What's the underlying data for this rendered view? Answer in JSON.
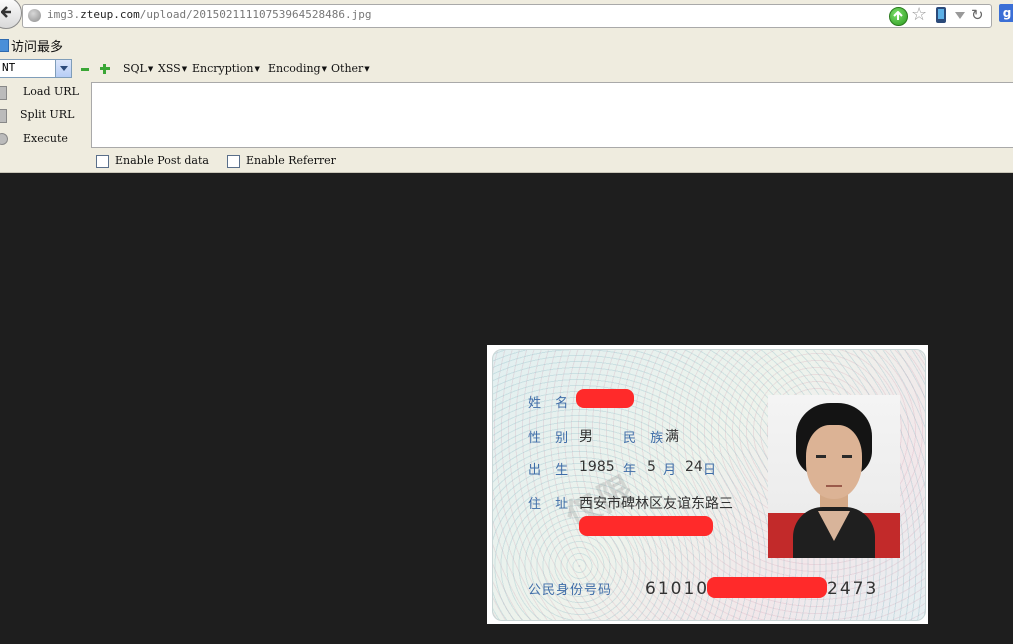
{
  "browser": {
    "url_prefix": "img3.",
    "url_domain": "zteup.com",
    "url_path": "/upload/20150211110753964528486.jpg"
  },
  "bookmarks": {
    "items": [
      {
        "label": "访问最多",
        "icon": "bookmark-folder-icon"
      }
    ]
  },
  "hackbar": {
    "select_value": "NT",
    "menus": [
      {
        "label": "SQL"
      },
      {
        "label": "XSS"
      },
      {
        "label": "Encryption"
      },
      {
        "label": "Encoding"
      },
      {
        "label": "Other"
      }
    ],
    "buttons": {
      "load_url": "Load URL",
      "split_url": "Split URL",
      "execute": "Execute"
    },
    "textarea_value": "",
    "checkboxes": {
      "post_data": "Enable Post data",
      "referrer": "Enable Referrer"
    }
  },
  "id_card": {
    "name_label": "姓 名",
    "gender_label": "性 别",
    "gender_value": "男",
    "ethnicity_label": "民 族",
    "ethnicity_value": "满",
    "birth_label": "出 生",
    "birth_year": "1985",
    "year_unit": "年",
    "birth_month": "5",
    "month_unit": "月",
    "birth_day": "24",
    "day_unit": "日",
    "address_label": "住 址",
    "address_value": "西安市碑林区友谊东路三",
    "id_number_label": "公民身份号码",
    "id_prefix": "61010",
    "id_suffix": "2473",
    "watermark": "仅限",
    "redaction_color": "#ff2a2a"
  },
  "colors": {
    "page_background": "#1e1e1e",
    "toolbar_background": "#efecdf",
    "card_label_color": "#3f6da8"
  }
}
